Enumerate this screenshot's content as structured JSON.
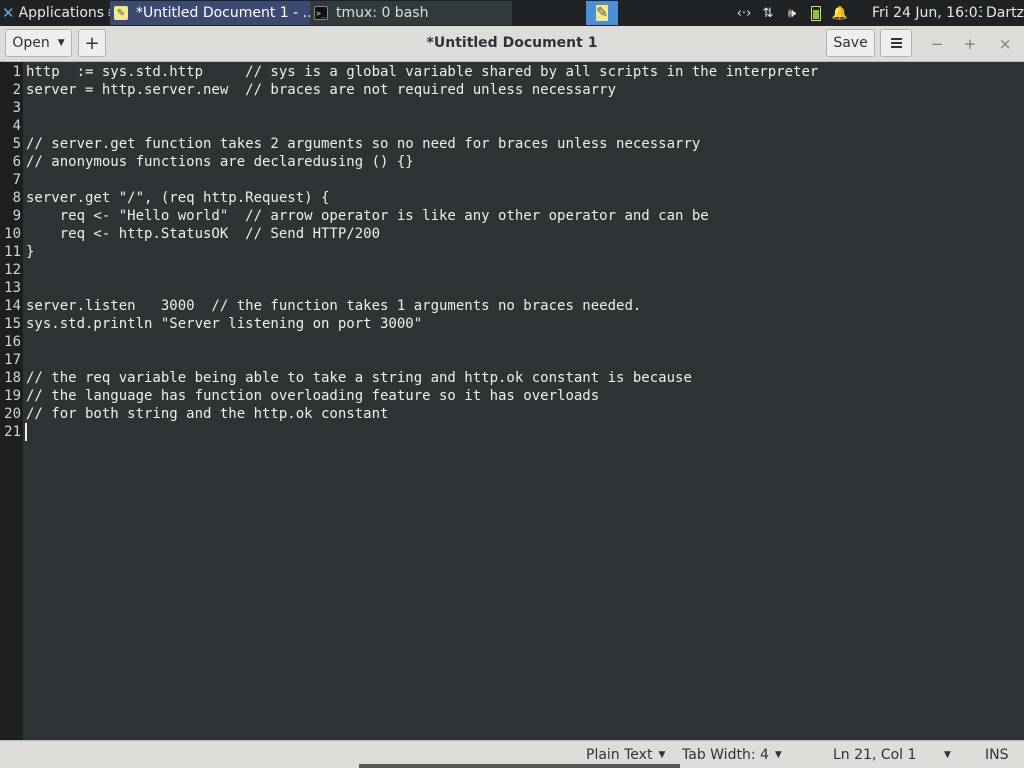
{
  "panel": {
    "apps_label": "Applications",
    "apps_suffix": "≡",
    "tasks": [
      {
        "label": "*Untitled Document 1 - …"
      },
      {
        "label": "tmux: 0 bash"
      }
    ],
    "clock": "Fri 24 Jun, 16:03",
    "user": "Dartz"
  },
  "header": {
    "open_label": "Open",
    "new_tab_label": "+",
    "title": "*Untitled Document 1",
    "save_label": "Save",
    "minimize_label": "−",
    "maximize_label": "+",
    "close_label": "×"
  },
  "editor": {
    "current_line": 21,
    "lines": [
      "http  := sys.std.http     // sys is a global variable shared by all scripts in the interpreter",
      "server = http.server.new  // braces are not required unless necessarry",
      "",
      "",
      "// server.get function takes 2 arguments so no need for braces unless necessarry",
      "// anonymous functions are declaredusing () {}",
      "",
      "server.get \"/\", (req http.Request) {",
      "    req <- \"Hello world\"  // arrow operator is like any other operator and can be",
      "    req <- http.StatusOK  // Send HTTP/200",
      "}",
      "",
      "",
      "server.listen   3000  // the function takes 1 arguments no braces needed.",
      "sys.std.println \"Server listening on port 3000\"",
      "",
      "",
      "// the req variable being able to take a string and http.ok constant is because",
      "// the language has function overloading feature so it has overloads",
      "// for both string and the http.ok constant",
      ""
    ]
  },
  "status": {
    "language": "Plain Text",
    "tab_width": "Tab Width: 4",
    "position": "Ln 21, Col 1",
    "mode": "INS"
  }
}
